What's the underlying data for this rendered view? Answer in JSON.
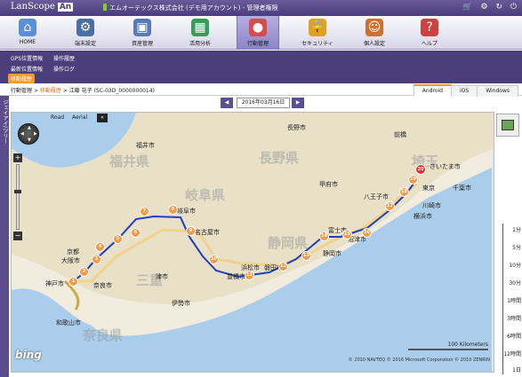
{
  "header": {
    "logo": "LanScope",
    "logo_badge": "An",
    "company": "エムオーテックス株式会社 (デモ用アカウント) - 管理者権限"
  },
  "nav": [
    {
      "label": "HOME",
      "icon": "home-icon",
      "color": "#5b8fd6"
    },
    {
      "label": "端末設定",
      "icon": "device-settings-icon",
      "color": "#4a6fa5"
    },
    {
      "label": "資産管理",
      "icon": "assets-icon",
      "color": "#5a7ab5"
    },
    {
      "label": "活用分析",
      "icon": "analysis-icon",
      "color": "#3a9a5a"
    },
    {
      "label": "行動管理",
      "icon": "location-icon",
      "color": "#d94a4a"
    },
    {
      "label": "セキュリティ",
      "icon": "lock-icon",
      "color": "#e0a020"
    },
    {
      "label": "個人設定",
      "icon": "user-icon",
      "color": "#d07030"
    },
    {
      "label": "ヘルプ",
      "icon": "help-icon",
      "color": "#d04040"
    }
  ],
  "subnav": {
    "gps": "GPS位置情報",
    "op": "操作履歴",
    "recent": "最新位置情報",
    "oplog": "操作ログ",
    "history": "移動履歴"
  },
  "breadcrumb": {
    "root": "行動管理",
    "sep": ">",
    "current": "移動履歴",
    "sep2": ">",
    "device": "江藤 花子 (SC-03D_0000000014)"
  },
  "tabs": [
    "Android",
    "iOS",
    "Windows"
  ],
  "sidebar": {
    "label": "ジェイアイ/ツリー"
  },
  "date": {
    "prev": "◀",
    "value": "2016年03月16日",
    "next": "▶"
  },
  "map": {
    "road": "Road",
    "aerial": "Aerial",
    "collapse": "«",
    "bing": "bing",
    "scale": "100 Kilometers",
    "copyright": "© 2010 NAVTEQ  © 2016 Microsoft Corporation  © 2010 ZENRIN",
    "cities": [
      {
        "name": "福井市"
      },
      {
        "name": "長野市"
      },
      {
        "name": "福井県"
      },
      {
        "name": "長野県"
      },
      {
        "name": "岐阜県"
      },
      {
        "name": "岐阜市"
      },
      {
        "name": "名古屋市"
      },
      {
        "name": "甲府市"
      },
      {
        "name": "静岡県"
      },
      {
        "name": "静岡市"
      },
      {
        "name": "浜松市"
      },
      {
        "name": "豊橋市"
      },
      {
        "name": "京都"
      },
      {
        "name": "大阪市"
      },
      {
        "name": "神戸市"
      },
      {
        "name": "奈良市"
      },
      {
        "name": "津市"
      },
      {
        "name": "三重"
      },
      {
        "name": "奈良県"
      },
      {
        "name": "和歌山市"
      },
      {
        "name": "さいたま市"
      },
      {
        "name": "千葉市"
      },
      {
        "name": "川崎市"
      },
      {
        "name": "横浜市"
      },
      {
        "name": "八王子市"
      },
      {
        "name": "沼津市"
      },
      {
        "name": "富士市"
      },
      {
        "name": "東京"
      },
      {
        "name": "前橋"
      },
      {
        "name": "埼玉"
      },
      {
        "name": "伊勢市"
      },
      {
        "name": "磐田市"
      }
    ],
    "pins": [
      "1",
      "2",
      "3",
      "4",
      "5",
      "6",
      "7",
      "8",
      "9",
      "10",
      "11",
      "12",
      "13",
      "14",
      "15",
      "16",
      "17",
      "18",
      "19",
      "20"
    ]
  },
  "timescale": [
    "1分",
    "5分",
    "10分",
    "30分",
    "1時間",
    "3時間",
    "6時間",
    "12時間",
    "1日"
  ]
}
